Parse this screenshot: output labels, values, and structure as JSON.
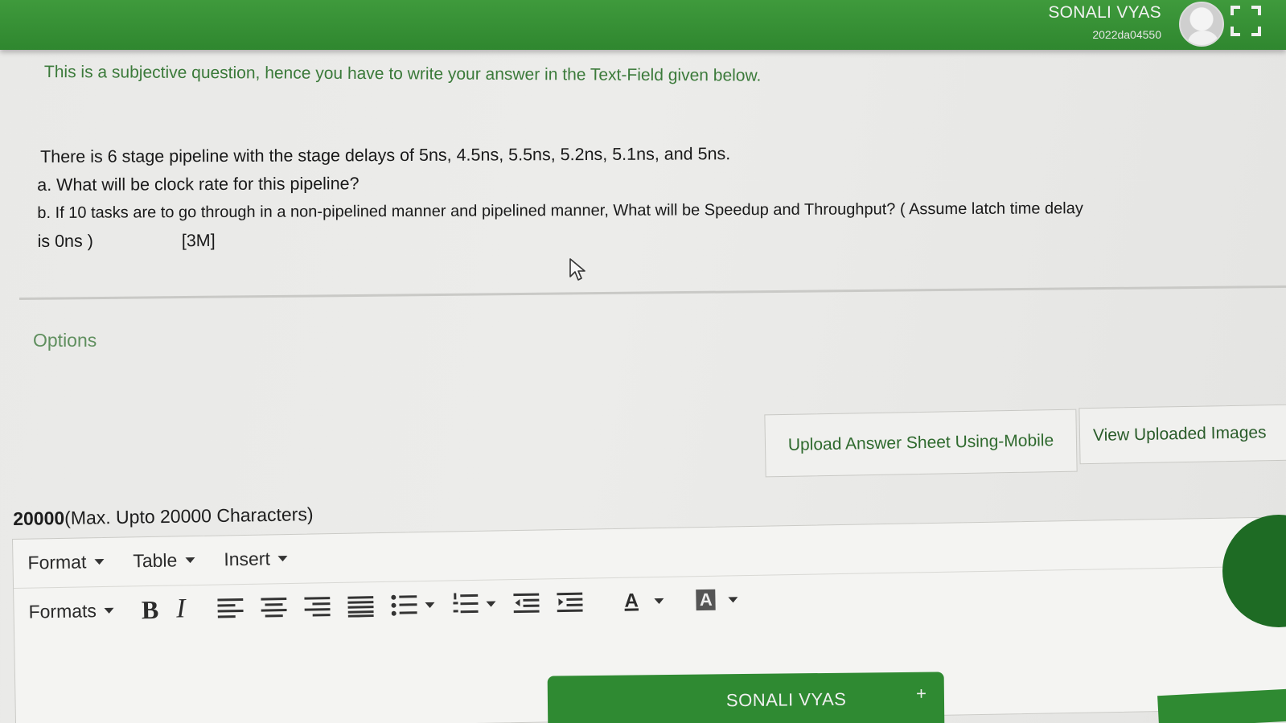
{
  "header": {
    "user_name": "SONALI VYAS",
    "user_id": "2022da04550"
  },
  "instruction": "This is a subjective question, hence you have to write your answer in the Text-Field given below.",
  "question": {
    "line1": "There is 6 stage pipeline with the stage delays of 5ns, 4.5ns, 5.5ns, 5.2ns, 5.1ns, and 5ns.",
    "line_a": "a. What will be clock rate for this pipeline?",
    "line_b": "b. If 10 tasks are to go through in a non-pipelined manner and pipelined manner, What will be Speedup and Throughput? ( Assume latch time delay",
    "line_c": "is  0ns )",
    "marks": "[3M]"
  },
  "options_label": "Options",
  "buttons": {
    "upload": "Upload Answer Sheet Using-Mobile",
    "view": "View Uploaded Images"
  },
  "char_limit": {
    "count": "20000",
    "text": "(Max. Upto 20000 Characters)"
  },
  "editor": {
    "menus": [
      "Format",
      "Table",
      "Insert"
    ],
    "formats_label": "Formats",
    "bold_label": "B",
    "italic_label": "I",
    "font_color_label": "A",
    "bg_color_label": "A"
  },
  "bottom_tab": {
    "label": "SONALI VYAS",
    "plus": "+"
  },
  "colors": {
    "header_green": "#2f872f",
    "instruction_green": "#3b7a3a"
  }
}
